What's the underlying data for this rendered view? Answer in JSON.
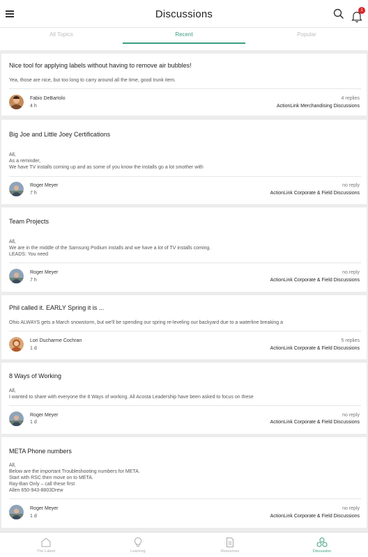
{
  "header": {
    "title": "Discussions",
    "notification_count": "1"
  },
  "tabs": [
    {
      "label": "All Topics",
      "active": false
    },
    {
      "label": "Recent",
      "active": true
    },
    {
      "label": "Popular",
      "active": false
    }
  ],
  "posts": [
    {
      "title": "Nice tool for applying labels without having to remove air bubbles!",
      "body": [
        "Yea, those are nice, but too long to carry around all the time, good trunk item."
      ],
      "author": "Fabio DeBartolo",
      "time": "4 h",
      "replies": "4 replies",
      "group": "ActionLink Merchandising Discussions"
    },
    {
      "title": "Big Joe and Little Joey Certifications",
      "body": [
        "All,",
        "As a reminder,",
        "We have TV installs coming up and as some of you know the installs go a lot smother with"
      ],
      "author": "Roger Meyer",
      "time": "7 h",
      "replies": "no reply",
      "group": "ActionLink Corporate & Field Discussions"
    },
    {
      "title": "Team Projects",
      "body": [
        "All,",
        "We are in the middle of the Samsung Podium installs and we have a lot of TV installs coming.",
        "LEADS: You need"
      ],
      "author": "Roger Meyer",
      "time": "7 h",
      "replies": "no reply",
      "group": "ActionLink Corporate & Field Discussions"
    },
    {
      "title": "Phil called it.   EARLY Spring it is ...",
      "body": [
        "Ohio ALWAYS gets a March snowstorm,  but we'll be spending our spring re-leveling our backyard due to a waterline breaking a"
      ],
      "author": "Lori Ducharme Cochran",
      "time": "1 d",
      "replies": "5 replies",
      "group": "ActionLink Corporate & Field Discussions"
    },
    {
      "title": "8 Ways of Working",
      "body": [
        "All,",
        "I wanted to share with everyone the 8 Ways of working. All Acosta Leadership have been asked to focus on these"
      ],
      "author": "Roger Meyer",
      "time": "1 d",
      "replies": "no reply",
      "group": "ActionLink Corporate & Field Discussions"
    },
    {
      "title": "META Phone numbers",
      "body": [
        "All,",
        "Below are the important Troubleshooting numbers for META.",
        "Start with RSC then move on to META.",
        "Ray-Ban Only – call these first",
        "Allen 650-943-8803Drew"
      ],
      "author": "Roger Meyer",
      "time": "1 d",
      "replies": "no reply",
      "group": "ActionLink Corporate & Field Discussions"
    }
  ],
  "bottom_nav": [
    {
      "label": "The Latest",
      "icon": "home-icon",
      "active": false
    },
    {
      "label": "Learning",
      "icon": "lightbulb-icon",
      "active": false
    },
    {
      "label": "Resources",
      "icon": "document-icon",
      "active": false
    },
    {
      "label": "Discussion",
      "icon": "discussion-icon",
      "active": true
    }
  ],
  "colors": {
    "accent": "#3e9d83",
    "badge": "#d9262b"
  }
}
